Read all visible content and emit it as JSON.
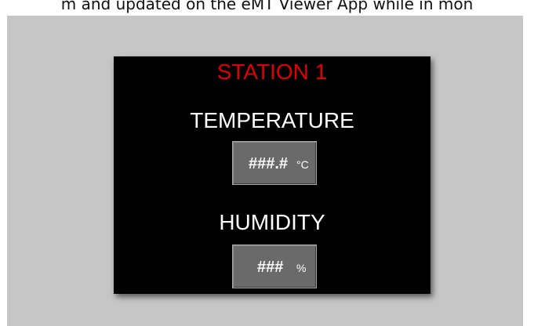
{
  "caption": "m and updated on the eMT Viewer App while in mon",
  "station": {
    "title": "STATION 1",
    "title_color": "#e00000",
    "temperature": {
      "label": "TEMPERATURE",
      "value": "###.#",
      "unit": "°C"
    },
    "humidity": {
      "label": "HUMIDITY",
      "value": "###",
      "unit": "%"
    }
  }
}
